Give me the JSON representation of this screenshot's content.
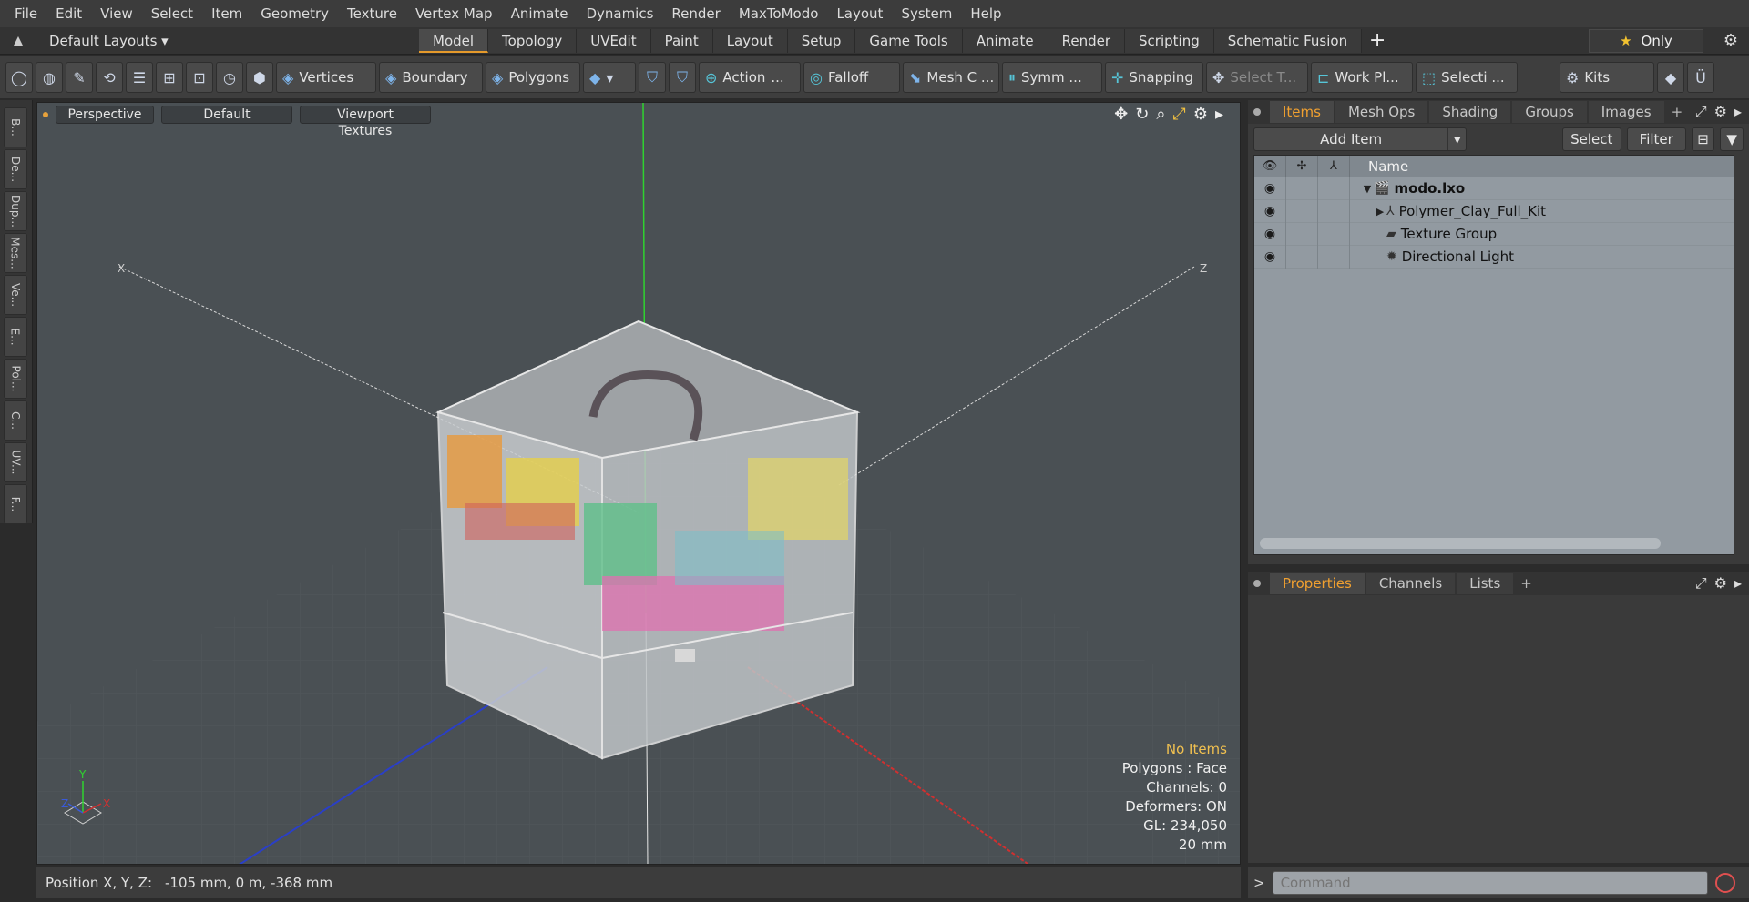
{
  "menu": [
    "File",
    "Edit",
    "View",
    "Select",
    "Item",
    "Geometry",
    "Texture",
    "Vertex Map",
    "Animate",
    "Dynamics",
    "Render",
    "MaxToModo",
    "Layout",
    "System",
    "Help"
  ],
  "layoutbar": {
    "layout_name": "Default Layouts ▾",
    "tabs": [
      "Model",
      "Topology",
      "UVEdit",
      "Paint",
      "Layout",
      "Setup",
      "Game Tools",
      "Animate",
      "Render",
      "Scripting",
      "Schematic Fusion"
    ],
    "active_tab": "Model",
    "only_label": "Only"
  },
  "toolbar": {
    "vertices": "Vertices",
    "boundary": "Boundary",
    "polygons": "Polygons",
    "action": "Action",
    "action_more": "...",
    "falloff": "Falloff",
    "mesh": "Mesh C ...",
    "symm": "Symm ...",
    "snapping": "Snapping",
    "select_t": "Select T...",
    "workplane": "Work Pl...",
    "selection": "Selecti ...",
    "kits": "Kits"
  },
  "sidetabs": [
    "B...",
    "De...",
    "Dup...",
    "Mes...",
    "Ve...",
    "E...",
    "Pol...",
    "C...",
    "UV...",
    "F..."
  ],
  "viewport": {
    "view": "Perspective",
    "shading": "Default",
    "textures": "Viewport Textures",
    "axis_labels": {
      "x": "X",
      "y": "Y",
      "z": "Z"
    },
    "info": {
      "items": "No Items",
      "polygons": "Polygons : Face",
      "channels": "Channels: 0",
      "deformers": "Deformers: ON",
      "gl": "GL: 234,050",
      "scale": "20 mm"
    }
  },
  "status": {
    "label": "Position X, Y, Z:",
    "value": "-105 mm, 0 m, -368 mm"
  },
  "items_panel": {
    "tabs": [
      "Items",
      "Mesh Ops",
      "Shading",
      "Groups",
      "Images"
    ],
    "active_tab": "Items",
    "add_item": "Add Item",
    "select": "Select",
    "filter": "Filter",
    "name_header": "Name",
    "rows": [
      {
        "label": "modo.lxo",
        "bold": true,
        "icon": "scene-icon"
      },
      {
        "label": "Polymer_Clay_Full_Kit",
        "bold": false,
        "icon": "mesh-icon"
      },
      {
        "label": "Texture Group",
        "bold": false,
        "icon": "folder-icon"
      },
      {
        "label": "Directional Light",
        "bold": false,
        "icon": "light-icon"
      }
    ]
  },
  "props_panel": {
    "tabs": [
      "Properties",
      "Channels",
      "Lists"
    ],
    "active_tab": "Properties"
  },
  "command": {
    "placeholder": "Command",
    "prompt": ">"
  },
  "colors": {
    "accent": "#e59a2b",
    "viewport_bg": "#4a5054",
    "y_axis": "#2fd22f",
    "x_axis": "#d03030",
    "z_axis": "#2a3fc8"
  }
}
